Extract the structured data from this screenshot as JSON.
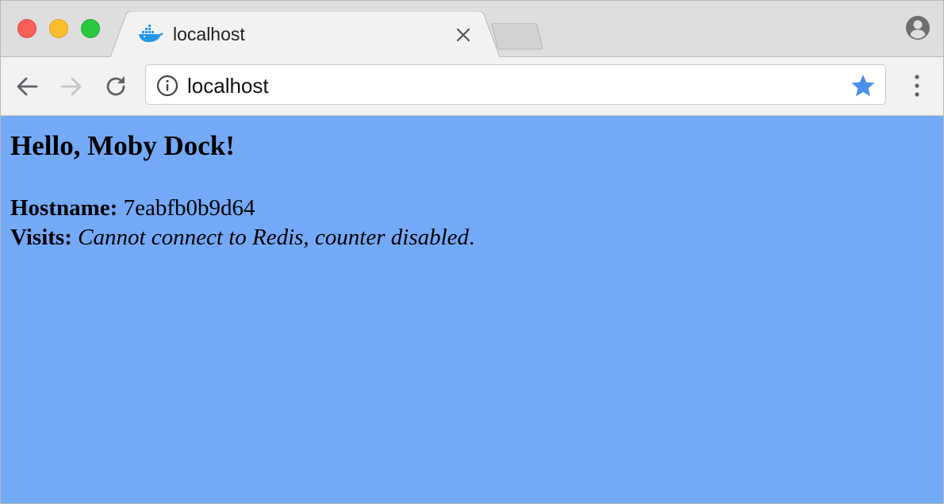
{
  "browser": {
    "tab": {
      "title": "localhost",
      "favicon": "docker-whale-icon"
    },
    "address_bar": {
      "url": "localhost"
    },
    "colors": {
      "close": "#fc5f57",
      "minimize": "#fdbc2e",
      "maximize": "#28c840",
      "star": "#4a8fe8",
      "page_background": "#74a9f7"
    }
  },
  "page": {
    "heading": "Hello, Moby Dock!",
    "hostname_label": "Hostname:",
    "hostname_value": "7eabfb0b9d64",
    "visits_label": "Visits:",
    "visits_value": "Cannot connect to Redis, counter disabled",
    "visits_suffix": "."
  }
}
